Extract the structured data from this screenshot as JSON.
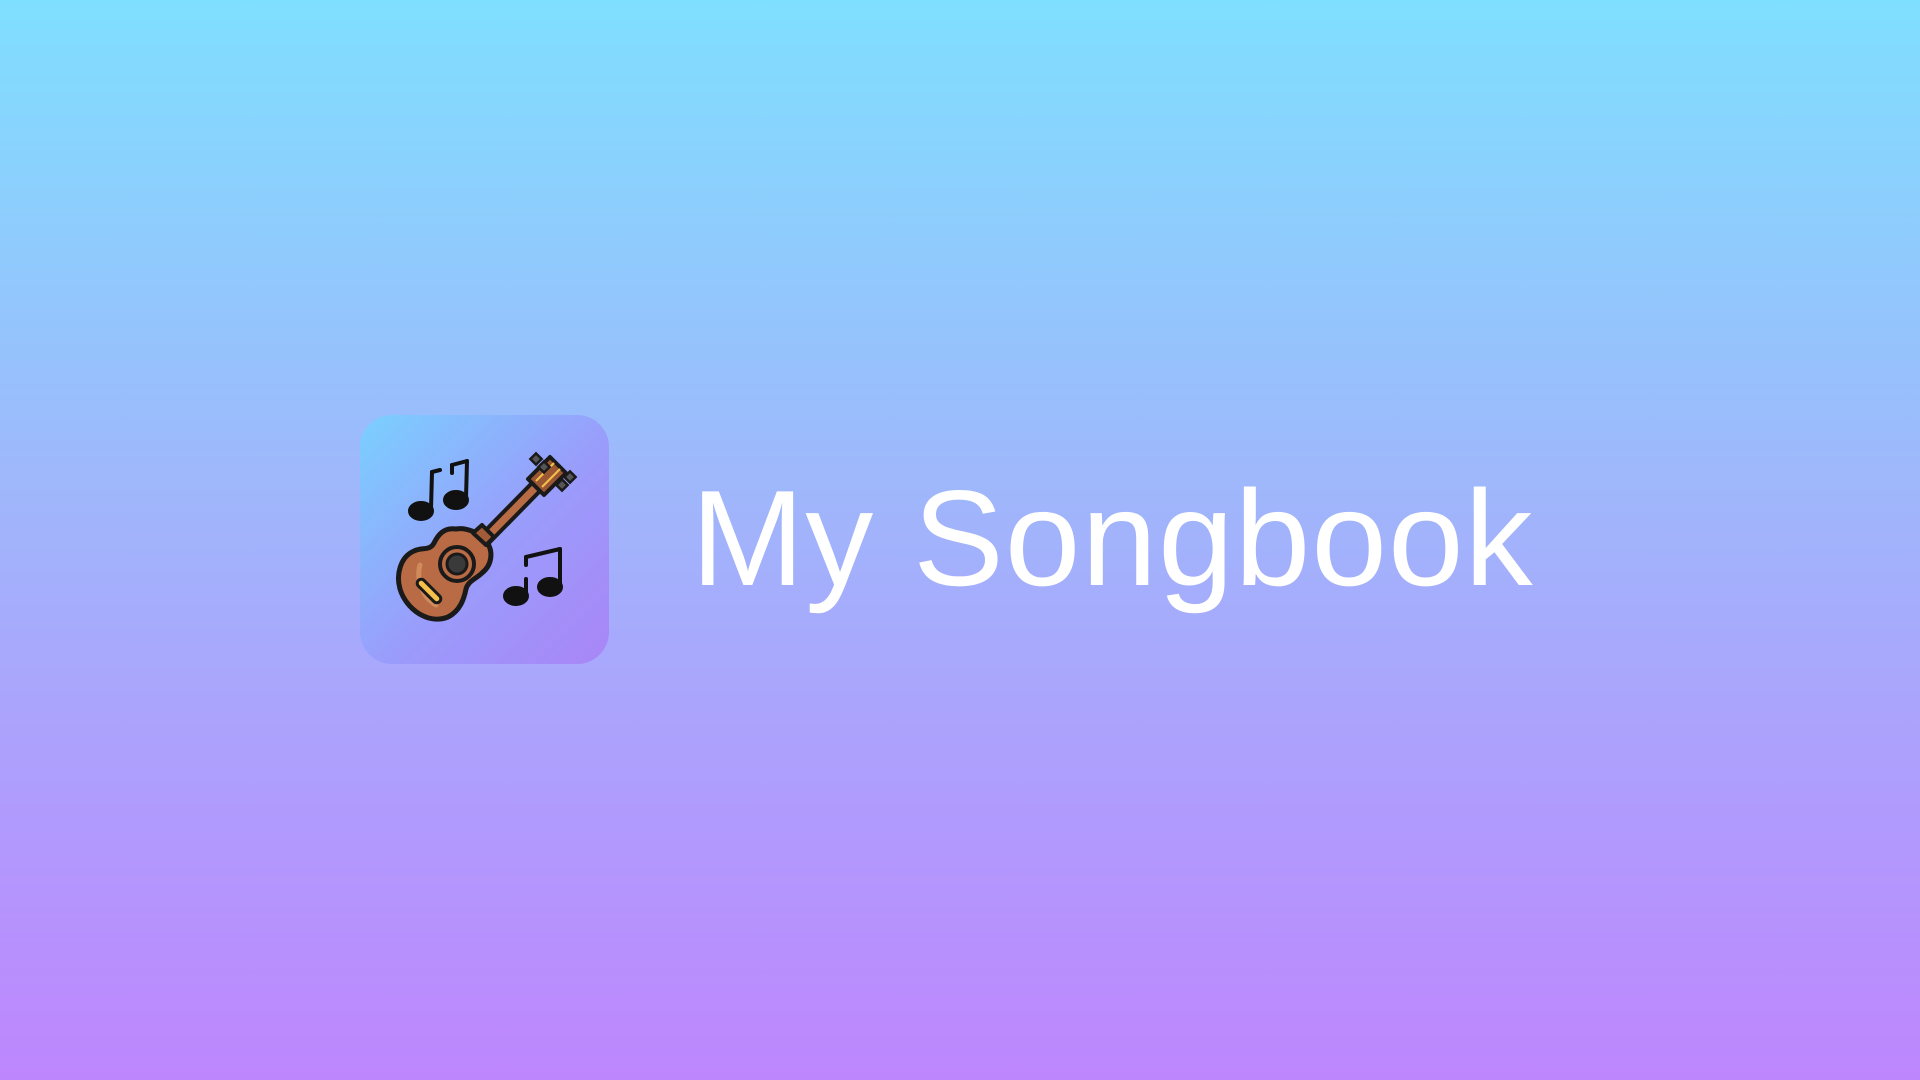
{
  "app": {
    "title": "My Songbook",
    "icon": "guitar-music-notes-icon"
  },
  "colors": {
    "background_top": "#7fdfff",
    "background_bottom": "#be86fd",
    "title_text": "#ffffff",
    "guitar_body": "#b86b44",
    "guitar_outline": "#1a1a1a"
  }
}
